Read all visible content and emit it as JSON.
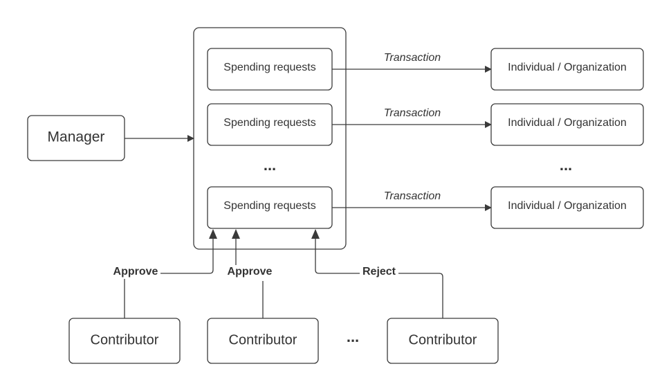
{
  "manager": "Manager",
  "spending_requests": [
    "Spending requests",
    "Spending requests",
    "Spending requests"
  ],
  "recipients": [
    "Individual / Organization",
    "Individual / Organization",
    "Individual / Organization"
  ],
  "transaction_labels": [
    "Transaction",
    "Transaction",
    "Transaction"
  ],
  "contributors": [
    "Contributor",
    "Contributor",
    "Contributor"
  ],
  "votes": [
    "Approve",
    "Approve",
    "Reject"
  ],
  "ellipsis": "...",
  "colors": {
    "stroke": "#3a3a3a",
    "text": "#333333"
  }
}
